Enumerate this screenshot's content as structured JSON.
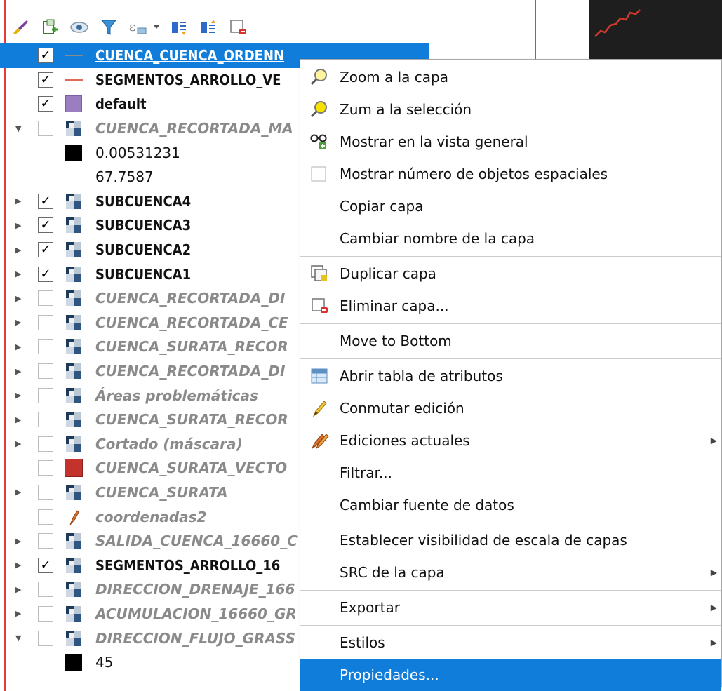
{
  "toolbar": {
    "icons": [
      "style-brush-icon",
      "add-group-icon",
      "eye-visibility-icon",
      "filter-funnel-icon",
      "expression-filter-icon",
      "dropdown-arrow-icon",
      "expand-all-icon",
      "collapse-all-icon",
      "remove-layer-icon"
    ]
  },
  "layers": [
    {
      "name": "CUENCA_CUENCA_ORDENN",
      "checked": true,
      "arrow": "",
      "symbol": "line-gray",
      "style": "b",
      "selected": true
    },
    {
      "name": "SEGMENTOS_ARROLLO_VE",
      "checked": true,
      "arrow": "",
      "symbol": "line-red",
      "style": "b"
    },
    {
      "name": "default",
      "checked": true,
      "arrow": "",
      "symbol": "fill-purple",
      "style": "b"
    },
    {
      "name": "CUENCA_RECORTADA_MA",
      "checked": false,
      "arrow": "down",
      "symbol": "raster",
      "style": "i"
    },
    {
      "name": "0.00531231",
      "checked": null,
      "arrow": "",
      "symbol": "swatch-black",
      "style": "plain"
    },
    {
      "name": "67.7587",
      "checked": null,
      "arrow": "",
      "symbol": "none",
      "style": "plain"
    },
    {
      "name": "SUBCUENCA4",
      "checked": true,
      "arrow": "right",
      "symbol": "raster",
      "style": "b"
    },
    {
      "name": "SUBCUENCA3",
      "checked": true,
      "arrow": "right",
      "symbol": "raster",
      "style": "b"
    },
    {
      "name": "SUBCUENCA2",
      "checked": true,
      "arrow": "right",
      "symbol": "raster",
      "style": "b"
    },
    {
      "name": "SUBCUENCA1",
      "checked": true,
      "arrow": "right",
      "symbol": "raster",
      "style": "b"
    },
    {
      "name": "CUENCA_RECORTADA_DI",
      "checked": false,
      "arrow": "right",
      "symbol": "raster",
      "style": "i"
    },
    {
      "name": "CUENCA_RECORTADA_CE",
      "checked": false,
      "arrow": "right",
      "symbol": "raster",
      "style": "i"
    },
    {
      "name": "CUENCA_SURATA_RECOR",
      "checked": false,
      "arrow": "right",
      "symbol": "raster",
      "style": "i"
    },
    {
      "name": "CUENCA_RECORTADA_DI",
      "checked": false,
      "arrow": "right",
      "symbol": "raster",
      "style": "i"
    },
    {
      "name": "Áreas problemáticas",
      "checked": false,
      "arrow": "right",
      "symbol": "raster",
      "style": "i"
    },
    {
      "name": "CUENCA_SURATA_RECOR",
      "checked": false,
      "arrow": "right",
      "symbol": "raster",
      "style": "i"
    },
    {
      "name": "Cortado (máscara)",
      "checked": false,
      "arrow": "right",
      "symbol": "raster",
      "style": "i"
    },
    {
      "name": "CUENCA_SURATA_VECTO",
      "checked": false,
      "arrow": "",
      "symbol": "fill-red",
      "style": "i"
    },
    {
      "name": "CUENCA_SURATA",
      "checked": false,
      "arrow": "right",
      "symbol": "raster",
      "style": "i"
    },
    {
      "name": "coordenadas2",
      "checked": false,
      "arrow": "",
      "symbol": "point-feather",
      "style": "i"
    },
    {
      "name": "SALIDA_CUENCA_16660_C",
      "checked": false,
      "arrow": "right",
      "symbol": "raster",
      "style": "i"
    },
    {
      "name": "SEGMENTOS_ARROLLO_16",
      "checked": true,
      "arrow": "right",
      "symbol": "raster",
      "style": "b"
    },
    {
      "name": "DIRECCION_DRENAJE_166",
      "checked": false,
      "arrow": "right",
      "symbol": "raster",
      "style": "i"
    },
    {
      "name": "ACUMULACION_16660_GR",
      "checked": false,
      "arrow": "right",
      "symbol": "raster",
      "style": "i"
    },
    {
      "name": "DIRECCION_FLUJO_GRASS",
      "checked": false,
      "arrow": "down",
      "symbol": "raster",
      "style": "i"
    },
    {
      "name": "45",
      "checked": null,
      "arrow": "",
      "symbol": "swatch-black",
      "style": "plain"
    }
  ],
  "menu": {
    "items": [
      {
        "label": "Zoom a la capa",
        "icon": "zoom-layer-icon",
        "type": "item",
        "top": 0
      },
      {
        "label": "Zum a la selección",
        "icon": "zoom-selection-icon",
        "type": "item"
      },
      {
        "label": "Mostrar en la vista general",
        "icon": "overview-glasses-icon",
        "type": "item"
      },
      {
        "label": "Mostrar número de objetos espaciales",
        "icon": "checkbox-icon",
        "type": "item"
      },
      {
        "label": "Copiar capa",
        "icon": "",
        "type": "item"
      },
      {
        "label": "Cambiar nombre de la capa",
        "icon": "",
        "type": "item"
      },
      {
        "type": "sep"
      },
      {
        "label": "Duplicar capa",
        "icon": "duplicate-layer-icon",
        "type": "item"
      },
      {
        "label": "Eliminar capa...",
        "icon": "remove-layer-icon",
        "type": "item"
      },
      {
        "type": "sep"
      },
      {
        "label": "Move to Bottom",
        "icon": "",
        "type": "item"
      },
      {
        "type": "sep"
      },
      {
        "label": "Abrir tabla de atributos",
        "icon": "attribute-table-icon",
        "type": "item"
      },
      {
        "label": "Conmutar edición",
        "icon": "pencil-icon",
        "type": "item"
      },
      {
        "label": "Ediciones actuales",
        "icon": "current-edits-icon",
        "type": "item",
        "submenu": true
      },
      {
        "label": "Filtrar...",
        "icon": "",
        "type": "item"
      },
      {
        "label": "Cambiar fuente de datos",
        "icon": "",
        "type": "item"
      },
      {
        "type": "sep"
      },
      {
        "label": "Establecer visibilidad de escala de capas",
        "icon": "",
        "type": "item"
      },
      {
        "label": "SRC de la capa",
        "icon": "",
        "type": "item",
        "submenu": true
      },
      {
        "type": "sep"
      },
      {
        "label": "Exportar",
        "icon": "",
        "type": "item",
        "submenu": true
      },
      {
        "type": "sep"
      },
      {
        "label": "Estilos",
        "icon": "",
        "type": "item",
        "submenu": true
      },
      {
        "label": "Propiedades...",
        "icon": "",
        "type": "item",
        "highlighted": true
      }
    ]
  },
  "colors": {
    "selection": "#0f7dd9",
    "red_line": "#e33b3b",
    "purple_fill": "#9b7ec2",
    "red_fill": "#c3322c"
  }
}
